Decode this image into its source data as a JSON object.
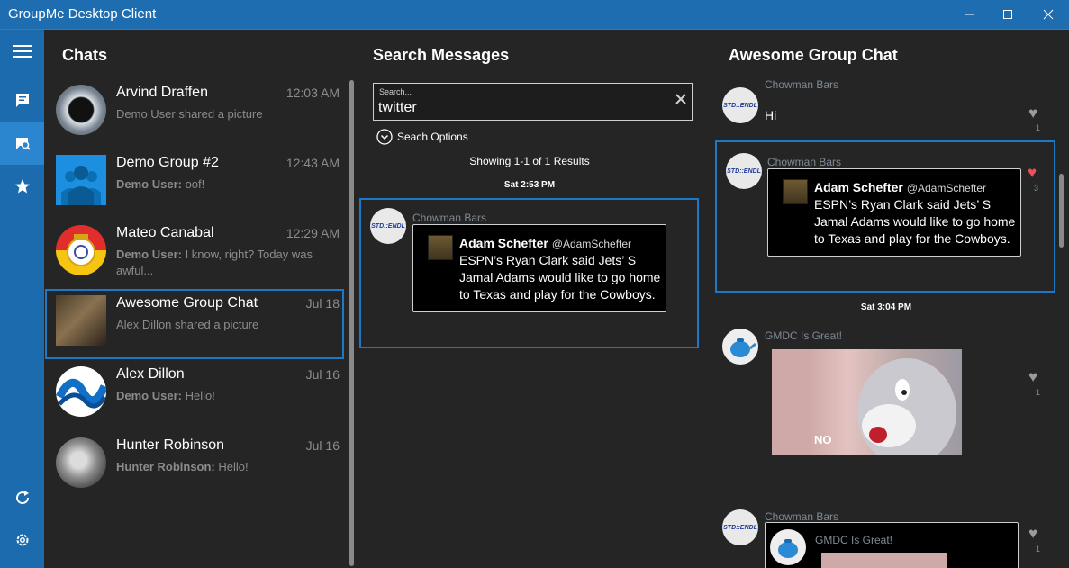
{
  "window": {
    "title": "GroupMe Desktop Client"
  },
  "rail": {
    "icons": [
      "menu-icon",
      "chat-icon",
      "search-chat-icon",
      "star-icon",
      "refresh-icon",
      "gear-icon"
    ]
  },
  "chats": {
    "title": "Chats",
    "items": [
      {
        "name": "Arvind Draffen",
        "time": "12:03 AM",
        "preview_author": "",
        "preview": "Demo User shared a picture"
      },
      {
        "name": "Demo Group #2",
        "time": "12:43 AM",
        "preview_author": "Demo User:",
        "preview": " oof!"
      },
      {
        "name": "Mateo Canabal",
        "time": "12:29 AM",
        "preview_author": "Demo User:",
        "preview": " I know, right? Today was awful..."
      },
      {
        "name": "Awesome Group Chat",
        "time": "Jul 18",
        "preview_author": "",
        "preview": "Alex Dillon shared a picture"
      },
      {
        "name": "Alex Dillon",
        "time": "Jul 16",
        "preview_author": "Demo User:",
        "preview": " Hello!"
      },
      {
        "name": "Hunter Robinson",
        "time": "Jul 16",
        "preview_author": "Hunter Robinson:",
        "preview": " Hello!"
      }
    ]
  },
  "search": {
    "title": "Search Messages",
    "placeholder": "Search...",
    "query": "twitter",
    "options_label": "Seach Options",
    "results_label": "Showing 1-1 of 1 Results",
    "date_label": "Sat 2:53 PM",
    "result": {
      "sender": "Chowman Bars",
      "avatar_text": "STD::ENDL",
      "tweet_author": "Adam Schefter",
      "tweet_handle": "@AdamSchefter",
      "tweet_text": "ESPN’s Ryan Clark said Jets’ S Jamal Adams would like to go home to Texas and play for the Cowboys."
    }
  },
  "group": {
    "title": "Awesome Group Chat",
    "messages": [
      {
        "sender": "Chowman Bars",
        "avatar_text": "STD::ENDL",
        "text": "Hi",
        "likes": "1"
      },
      {
        "sender": "Chowman Bars",
        "avatar_text": "STD::ENDL",
        "tweet_author": "Adam Schefter",
        "tweet_handle": "@AdamSchefter",
        "tweet_text": "ESPN’s Ryan Clark said Jets’ S Jamal Adams would like to go home to Texas and play for the Cowboys.",
        "likes": "3"
      },
      {
        "date_label": "Sat 3:04 PM"
      },
      {
        "sender": "GMDC Is Great!",
        "image_caption": "NO",
        "likes": "1"
      },
      {
        "sender": "Chowman Bars",
        "avatar_text": "STD::ENDL",
        "nested_sender": "GMDC Is Great!",
        "likes": "1"
      }
    ]
  },
  "colors": {
    "accent": "#1e6db1",
    "selected_outline": "#1e78c8",
    "liked_heart": "#e8505b"
  }
}
